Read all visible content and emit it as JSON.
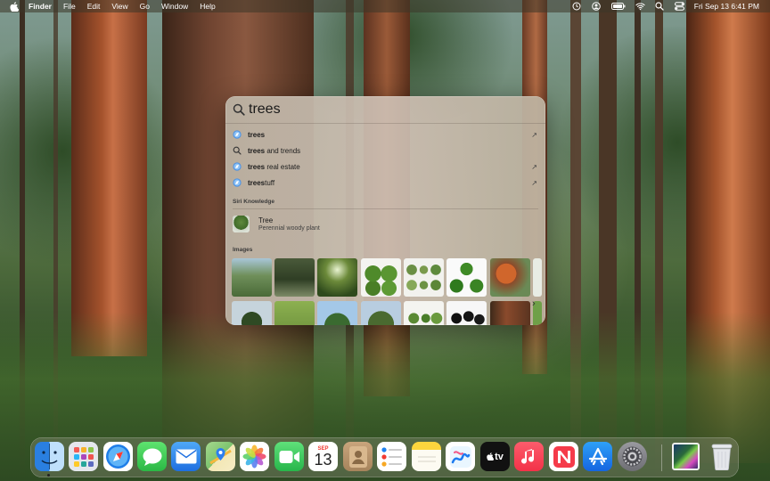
{
  "menubar": {
    "app_name": "Finder",
    "items": [
      "File",
      "Edit",
      "View",
      "Go",
      "Window",
      "Help"
    ],
    "status_icons": [
      "screen-time-icon",
      "user-icon",
      "battery-icon",
      "wifi-icon",
      "spotlight-search-icon",
      "control-center-icon"
    ],
    "clock": "Fri Sep 13  6:41 PM"
  },
  "spotlight": {
    "query": "trees",
    "suggestions": [
      {
        "icon": "safari-icon",
        "bold": "trees",
        "rest": "",
        "has_arrow": true
      },
      {
        "icon": "search-icon",
        "bold": "trees",
        "rest": " and trends",
        "has_arrow": false
      },
      {
        "icon": "safari-icon",
        "bold": "trees",
        "rest": " real estate",
        "has_arrow": true
      },
      {
        "icon": "safari-icon",
        "bold": "trees",
        "rest": "tuff",
        "has_arrow": true
      }
    ],
    "arrow_glyph": "↗",
    "siri_knowledge": {
      "section_title": "Siri Knowledge",
      "title": "Tree",
      "subtitle": "Perennial woody plant"
    },
    "images": {
      "section_title": "Images",
      "next_glyph": "›"
    }
  },
  "dock": {
    "apps": [
      {
        "name": "finder-icon",
        "color": "#3b8de0"
      },
      {
        "name": "launchpad-icon",
        "color": "#d9dde3"
      },
      {
        "name": "safari-icon",
        "color": "#1f7ee8"
      },
      {
        "name": "messages-icon",
        "color": "#3ccf56"
      },
      {
        "name": "mail-icon",
        "color": "#2f86e6"
      },
      {
        "name": "maps-icon",
        "color": "#7cc36e"
      },
      {
        "name": "photos-icon",
        "color": "#ffffff"
      },
      {
        "name": "facetime-icon",
        "color": "#35c759"
      },
      {
        "name": "calendar-icon",
        "color": "#ffffff"
      },
      {
        "name": "contacts-icon",
        "color": "#b6916a"
      },
      {
        "name": "reminders-icon",
        "color": "#ffffff"
      },
      {
        "name": "notes-icon",
        "color": "#fbd13a"
      },
      {
        "name": "freeform-icon",
        "color": "#ffffff"
      },
      {
        "name": "apple-tv-icon",
        "color": "#111111"
      },
      {
        "name": "music-icon",
        "color": "#fa3a4f"
      },
      {
        "name": "news-icon",
        "color": "#ffffff"
      },
      {
        "name": "app-store-icon",
        "color": "#1a82f0"
      },
      {
        "name": "system-settings-icon",
        "color": "#8e8e93"
      }
    ],
    "calendar": {
      "month": "SEP",
      "day": "13"
    },
    "tv_label": "tv",
    "downloads_stack": "downloads-stack-icon",
    "trash": "trash-icon"
  }
}
